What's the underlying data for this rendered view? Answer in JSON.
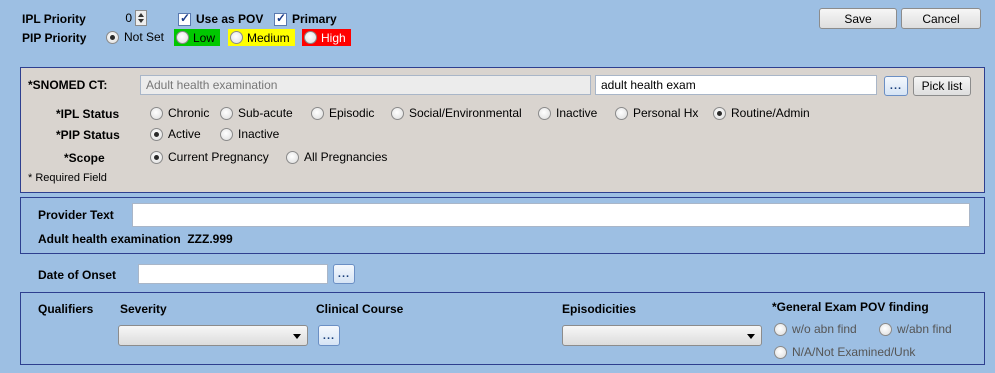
{
  "header": {
    "ipl_priority_label": "IPL Priority",
    "ipl_priority_value": "0",
    "use_as_pov_label": "Use as POV",
    "primary_label": "Primary",
    "pip_priority_label": "PIP Priority",
    "pip_options": {
      "not_set": "Not Set",
      "low": "Low",
      "medium": "Medium",
      "high": "High"
    },
    "save_label": "Save",
    "cancel_label": "Cancel"
  },
  "snomed": {
    "label": "SNOMED CT:",
    "value": "Adult health examination",
    "search_value": "adult health exam",
    "browse_label": "...",
    "pick_list_label": "Pick list"
  },
  "ipl_status": {
    "label": "IPL Status",
    "options": [
      "Chronic",
      "Sub-acute",
      "Episodic",
      "Social/Environmental",
      "Inactive",
      "Personal Hx",
      "Routine/Admin"
    ],
    "selected": "Routine/Admin"
  },
  "pip_status": {
    "label": "PIP Status",
    "options": [
      "Active",
      "Inactive"
    ],
    "selected": "Active"
  },
  "scope": {
    "label": "Scope",
    "options": [
      "Current Pregnancy",
      "All Pregnancies"
    ],
    "selected": "Current Pregnancy"
  },
  "required_note": "Required Field",
  "provider": {
    "label": "Provider Text",
    "value": "",
    "code_line": "Adult health examination  ZZZ.999"
  },
  "onset": {
    "label": "Date of Onset",
    "value": "",
    "browse_label": "..."
  },
  "qualifiers": {
    "label": "Qualifiers",
    "severity_label": "Severity",
    "clinical_course_label": "Clinical Course",
    "clinical_course_browse": "...",
    "episodicities_label": "Episodicities",
    "general_exam_label": "General Exam POV finding",
    "general_exam_options": [
      "w/o abn find",
      "w/abn find",
      "N/A/Not Examined/Unk"
    ]
  },
  "colors": {
    "low": "#00c800",
    "medium": "#ffff00",
    "high": "#ff0000",
    "panel_border": "#2e3f8f",
    "background": "#9dbfe3"
  }
}
